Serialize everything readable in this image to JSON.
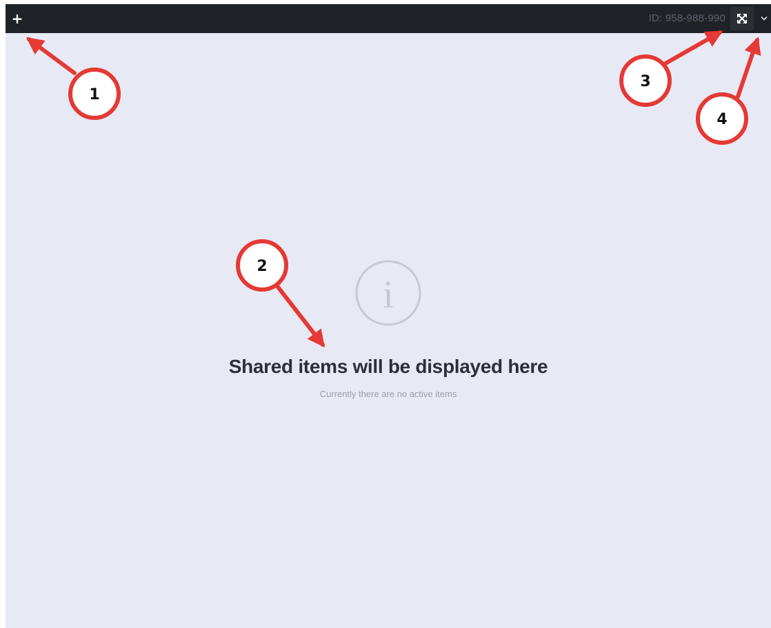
{
  "toolbar": {
    "add_label": "+",
    "session_id": "ID: 958-988-990",
    "expand_icon": "expand-arrows-icon",
    "menu_icon": "chevron-down-icon"
  },
  "empty_state": {
    "icon": "info-circle-icon",
    "icon_glyph": "i",
    "title": "Shared items will be displayed here",
    "subtitle": "Currently there are no active items"
  },
  "callouts": [
    {
      "number": "1"
    },
    {
      "number": "2"
    },
    {
      "number": "3"
    },
    {
      "number": "4"
    }
  ],
  "colors": {
    "toolbar_bg": "#1f2226",
    "canvas_bg": "#e7eaf5",
    "callout_red": "#e53935",
    "title_text": "#2b2f3a"
  }
}
